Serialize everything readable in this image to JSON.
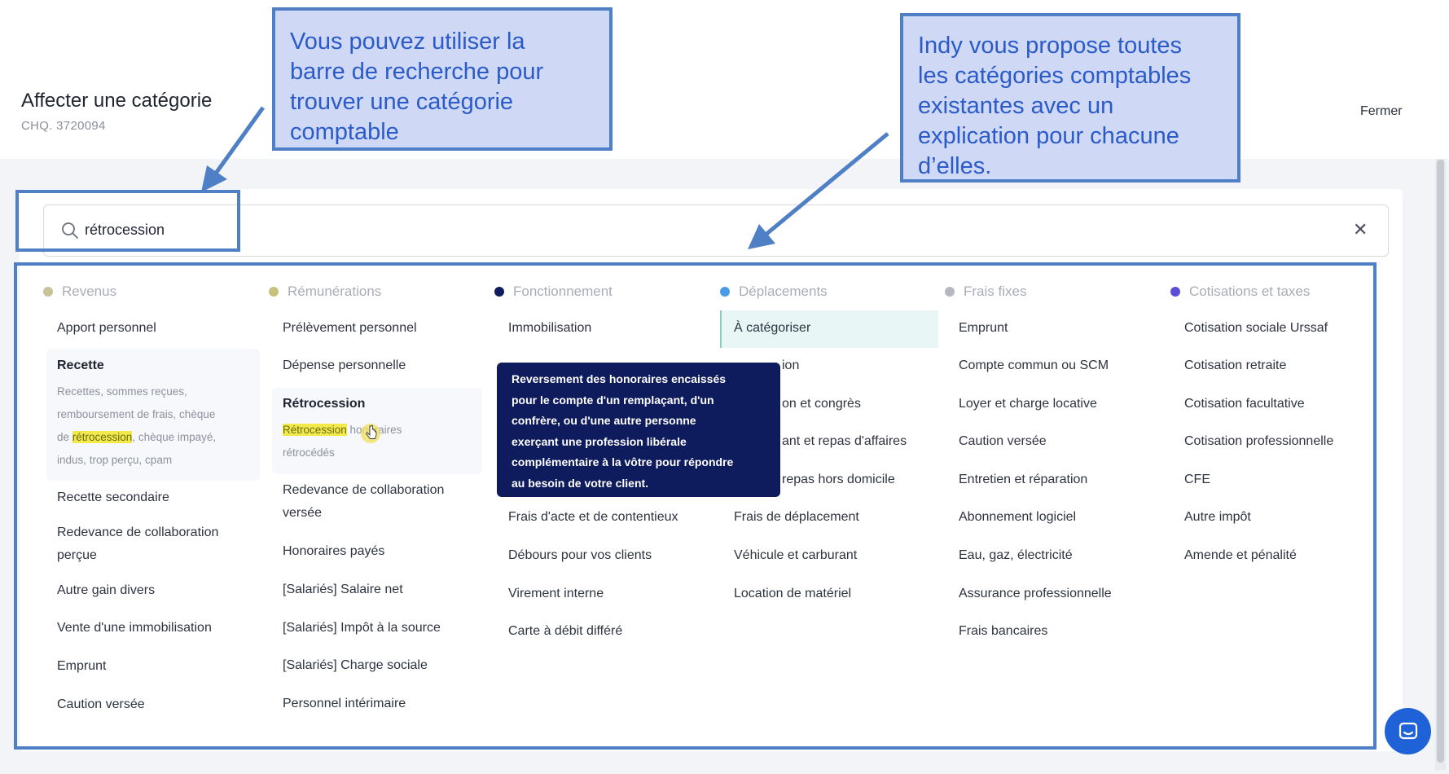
{
  "header": {
    "title": "Affecter une catégorie",
    "subtitle": "CHQ. 3720094",
    "close_label": "Fermer"
  },
  "search": {
    "value": "rétrocession",
    "clear_icon": "close-icon"
  },
  "columns": [
    {
      "title": "Revenus",
      "dot_color": "#c8c29a",
      "items": [
        "Apport personnel",
        "Recette",
        "Recette secondaire",
        "Redevance de collaboration perçue",
        "Autre gain divers",
        "Vente d'une immobilisation",
        "Emprunt",
        "Caution versée"
      ],
      "recette_desc": {
        "line1": "Recettes, sommes reçues,",
        "line2": "remboursement de frais, chèque",
        "line3_pre": "de ",
        "line3_hl": "rétrocession",
        "line3_post": ", chèque impayé,",
        "line4": "indus, trop perçu, cpam"
      }
    },
    {
      "title": "Rémunérations",
      "dot_color": "#c7c27a",
      "items": [
        "Prélèvement personnel",
        "Dépense personnelle",
        "Rétrocession",
        "Redevance de collaboration versée",
        "Honoraires payés",
        "[Salariés] Salaire net",
        "[Salariés] Impôt à la source",
        "[Salariés] Charge sociale",
        "Personnel intérimaire"
      ],
      "retro_desc": {
        "hl": "Rétrocession",
        "post": " honoraires",
        "line2": "rétrocédés"
      }
    },
    {
      "title": "Fonctionnement",
      "dot_color": "#0e1b5c",
      "items": [
        "Immobilisation",
        "Frais d'acte et de contentieux",
        "Débours pour vos clients",
        "Virement interne",
        "Carte à débit différé"
      ]
    },
    {
      "title": "Déplacements",
      "dot_color": "#4a9be3",
      "items": [
        "À catégoriser",
        "ion",
        "on et congrès",
        "ant et repas d'affaires",
        "repas hors domicile",
        "Frais de déplacement",
        "Véhicule et carburant",
        "Location de matériel"
      ]
    },
    {
      "title": "Frais fixes",
      "dot_color": "#b5b8c2",
      "items": [
        "Emprunt",
        "Compte commun ou SCM",
        "Loyer et charge locative",
        "Caution versée",
        "Entretien et réparation",
        "Abonnement logiciel",
        "Eau, gaz, électricité",
        "Assurance professionnelle",
        "Frais bancaires"
      ]
    },
    {
      "title": "Cotisations et taxes",
      "dot_color": "#5a50d8",
      "items": [
        "Cotisation sociale Urssaf",
        "Cotisation retraite",
        "Cotisation facultative",
        "Cotisation professionnelle",
        "CFE",
        "Autre impôt",
        "Amende et pénalité"
      ]
    }
  ],
  "tooltip": {
    "line1": "Reversement des honoraires encaissés",
    "line2": "pour le compte d'un remplaçant, d'un",
    "line3": "confrère, ou d'une autre personne",
    "line4": "exerçant une profession libérale",
    "line5": "complémentaire à la vôtre pour répondre",
    "line6": "au besoin de votre client."
  },
  "annotations": {
    "callout_search": {
      "line1": "Vous pouvez utiliser la",
      "line2": "barre de recherche pour",
      "line3": "trouver une catégorie",
      "line4": "comptable"
    },
    "callout_categories": {
      "line1": "Indy vous propose toutes",
      "line2": "les catégories comptables",
      "line3": "existantes avec un",
      "line4": "explication pour chacune",
      "line5": "d’elles."
    },
    "color": "#4f7fc4"
  }
}
